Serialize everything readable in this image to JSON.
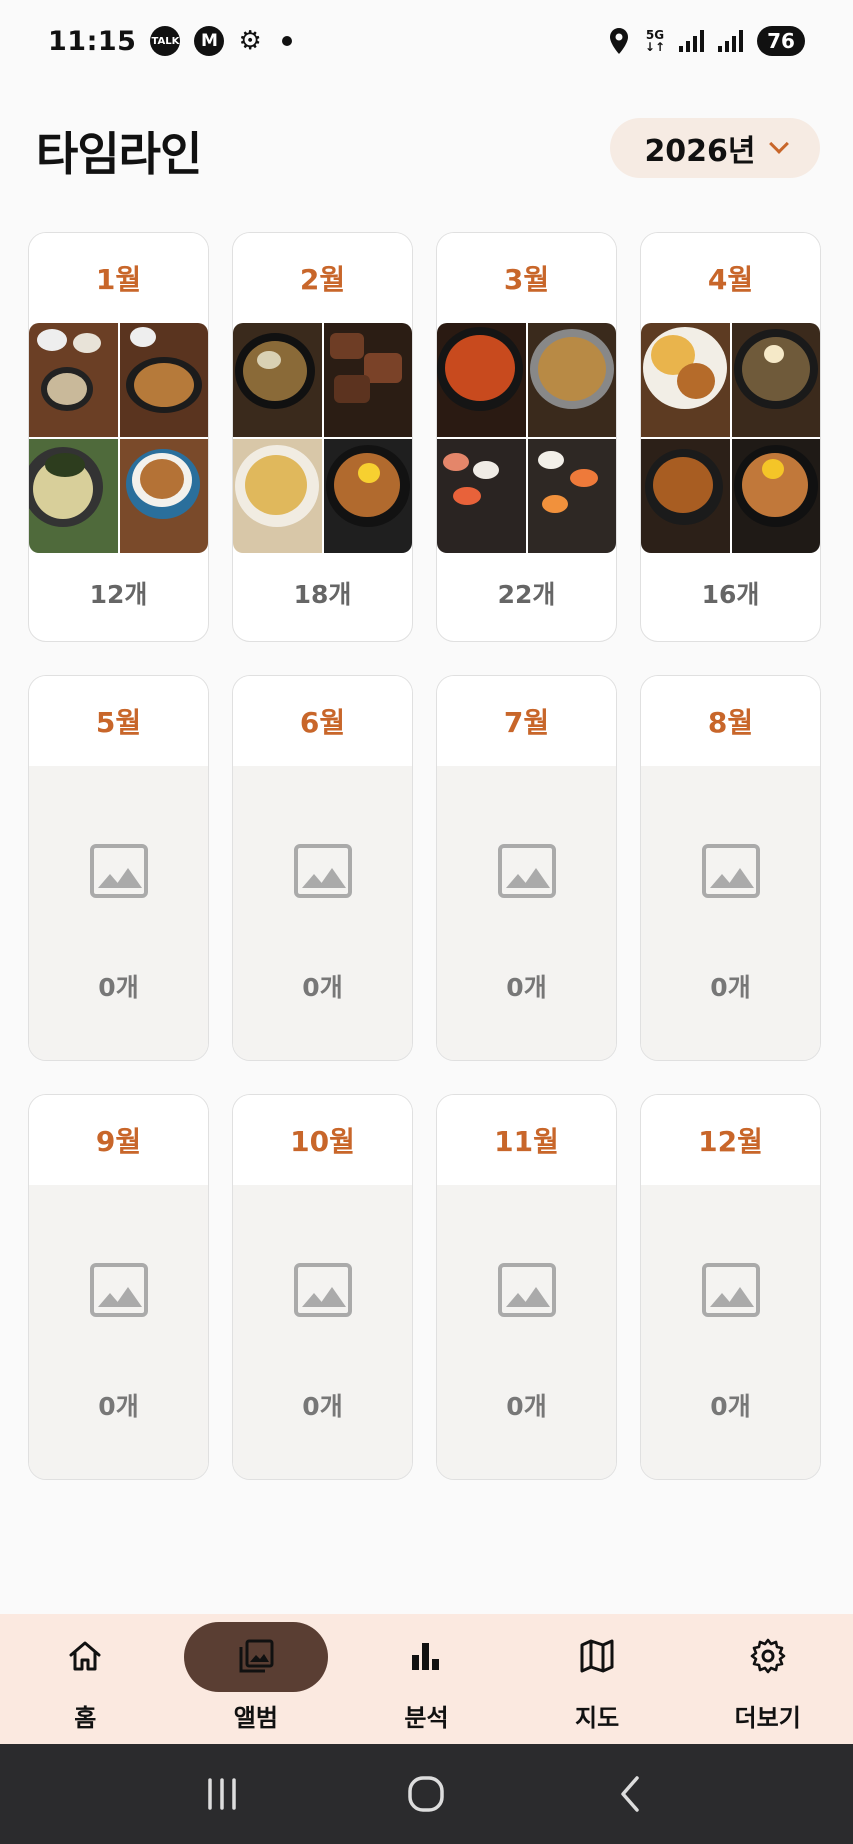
{
  "status_bar": {
    "time": "11:15",
    "talk_icon_text": "TALK",
    "m_icon_text": "M",
    "network_label": "5G",
    "battery": "76"
  },
  "header": {
    "title": "타임라인",
    "year_label": "2026년"
  },
  "months": [
    {
      "label": "1월",
      "count": "12개",
      "has_photos": true
    },
    {
      "label": "2월",
      "count": "18개",
      "has_photos": true
    },
    {
      "label": "3월",
      "count": "22개",
      "has_photos": true
    },
    {
      "label": "4월",
      "count": "16개",
      "has_photos": true
    },
    {
      "label": "5월",
      "count": "0개",
      "has_photos": false
    },
    {
      "label": "6월",
      "count": "0개",
      "has_photos": false
    },
    {
      "label": "7월",
      "count": "0개",
      "has_photos": false
    },
    {
      "label": "8월",
      "count": "0개",
      "has_photos": false
    },
    {
      "label": "9월",
      "count": "0개",
      "has_photos": false
    },
    {
      "label": "10월",
      "count": "0개",
      "has_photos": false
    },
    {
      "label": "11월",
      "count": "0개",
      "has_photos": false
    },
    {
      "label": "12월",
      "count": "0개",
      "has_photos": false
    }
  ],
  "bottom_nav": {
    "items": [
      {
        "label": "홈",
        "icon": "home-icon",
        "active": false
      },
      {
        "label": "앨범",
        "icon": "album-icon",
        "active": true
      },
      {
        "label": "분석",
        "icon": "bar-chart-icon",
        "active": false
      },
      {
        "label": "지도",
        "icon": "map-icon",
        "active": false
      },
      {
        "label": "더보기",
        "icon": "gear-icon",
        "active": false
      }
    ]
  },
  "colors": {
    "accent": "#c8662a",
    "nav_bg": "#fbe9e0",
    "nav_active_pill": "#5a3e33",
    "year_pill_bg": "#f6ebe3"
  }
}
